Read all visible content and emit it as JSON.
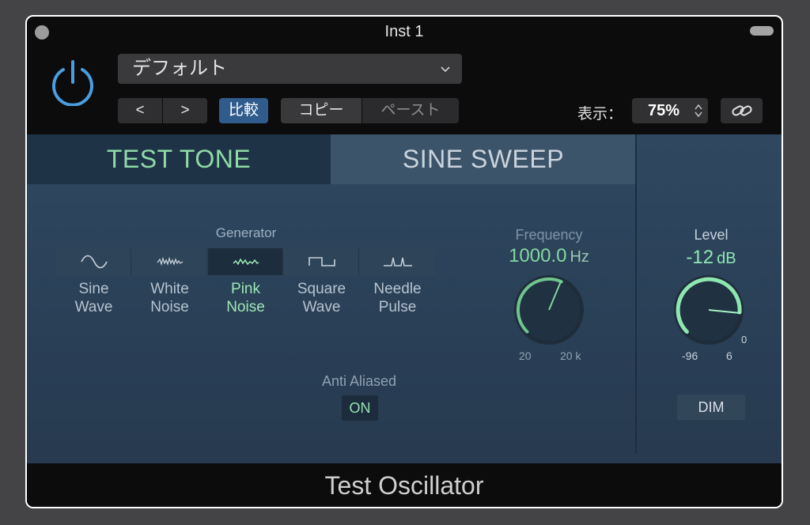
{
  "window": {
    "title": "Inst 1"
  },
  "header": {
    "preset": "デフォルト",
    "nav_prev": "<",
    "nav_next": ">",
    "compare": "比較",
    "copy": "コピー",
    "paste": "ペースト",
    "view_label": "表示：",
    "zoom": "75%"
  },
  "tabs": [
    {
      "label": "TEST TONE",
      "selected": true
    },
    {
      "label": "SINE SWEEP",
      "selected": false
    }
  ],
  "generator": {
    "label": "Generator",
    "selected_index": 2,
    "options": [
      {
        "line1": "Sine",
        "line2": "Wave",
        "icon": "sine-wave-icon"
      },
      {
        "line1": "White",
        "line2": "Noise",
        "icon": "white-noise-icon"
      },
      {
        "line1": "Pink",
        "line2": "Noise",
        "icon": "pink-noise-icon"
      },
      {
        "line1": "Square",
        "line2": "Wave",
        "icon": "square-wave-icon"
      },
      {
        "line1": "Needle",
        "line2": "Pulse",
        "icon": "needle-pulse-icon"
      }
    ]
  },
  "anti_aliased": {
    "label": "Anti Aliased",
    "value": "ON"
  },
  "frequency": {
    "label": "Frequency",
    "value": "1000.0",
    "unit": "Hz",
    "min": "20",
    "max": "20 k"
  },
  "level": {
    "label": "Level",
    "value": "-12",
    "unit": "dB",
    "min": "-96",
    "max": "6",
    "zero_mark": "0"
  },
  "dim": {
    "label": "DIM"
  },
  "footer": {
    "plugin_name": "Test Oscillator"
  },
  "colors": {
    "accent_green": "#8ee7b0",
    "compare_blue": "#2f5b8d",
    "power_blue": "#4a9ee0"
  }
}
